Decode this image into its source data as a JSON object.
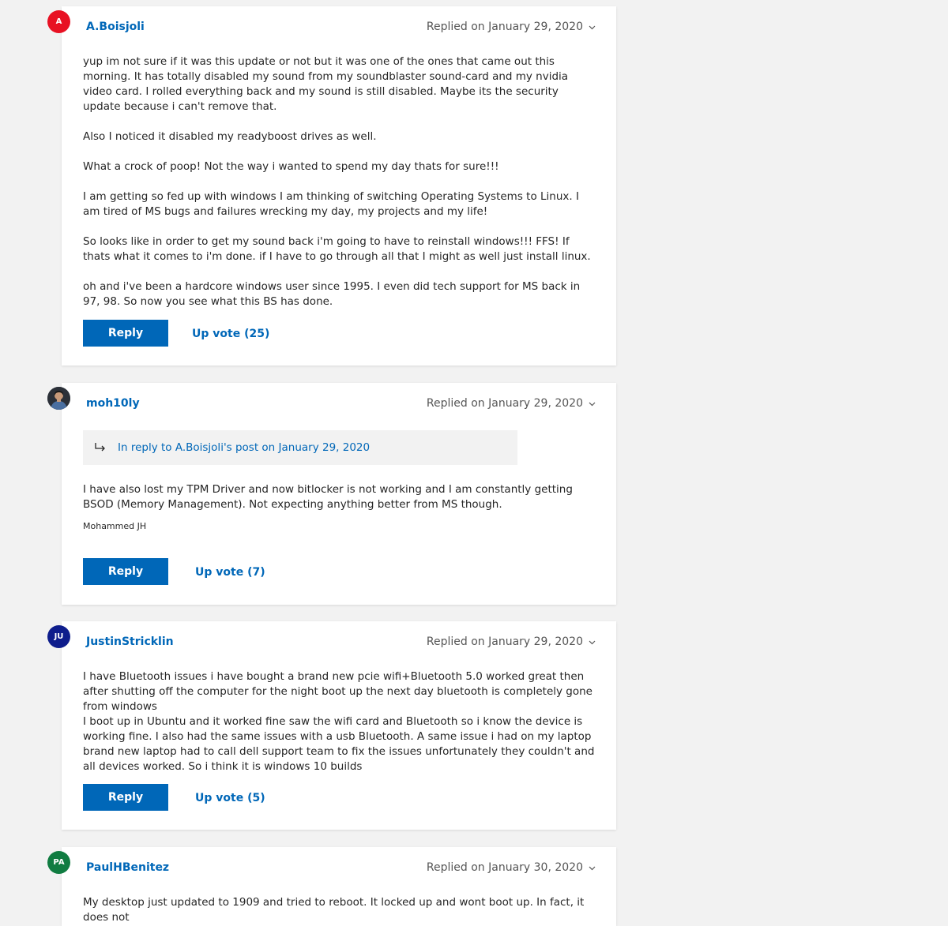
{
  "posts": [
    {
      "author": "A.Boisjoli",
      "avatar_initials": "A",
      "avatar_color": "#e81123",
      "replied": "Replied on January 29, 2020",
      "paragraphs": [
        "yup im not sure if it was this update or not but it was one of the ones that came out this morning. It has totally disabled my sound from my soundblaster sound-card and my nvidia video card. I rolled everything back and my sound is still disabled. Maybe its the security update because i can't remove that.",
        "Also I noticed it disabled my readyboost drives as well.",
        "What a crock of poop! Not the way i wanted to spend my day thats for sure!!!",
        "I am getting so fed up with windows I am thinking of switching Operating Systems to Linux. I am tired of MS bugs and failures wrecking my day, my projects and my life!",
        "So looks like in order to get my sound back i'm going to have to reinstall windows!!! FFS! If thats what it comes to i'm done. if I have to go through all that I might as well just install linux.",
        "oh and i've been a hardcore windows user since 1995. I even did tech support for MS back in 97, 98. So now you see what this BS has done."
      ],
      "reply_label": "Reply",
      "upvote_label": "Up vote (25)"
    },
    {
      "author": "moh10ly",
      "avatar_icon": "user-photo-icon",
      "replied": "Replied on January 29, 2020",
      "in_reply_to": "In reply to A.Boisjoli's post on January 29, 2020",
      "paragraphs": [
        "I have also lost my TPM Driver and now bitlocker is not working and I am constantly getting BSOD (Memory Management). Not expecting anything better from MS though."
      ],
      "signature": "Mohammed JH",
      "reply_label": "Reply",
      "upvote_label": "Up vote (7)"
    },
    {
      "author": "JustinStricklin",
      "avatar_initials": "JU",
      "avatar_color": "#0e1d8c",
      "replied": "Replied on January 29, 2020",
      "paragraphs": [
        "I have Bluetooth issues i have bought a brand new pcie wifi+Bluetooth 5.0 worked great then after shutting off the computer for the night boot up the next day bluetooth is completely gone from windows\nI boot up in Ubuntu and it worked fine saw the wifi card and Bluetooth so i know the device is working fine. I also had the same issues with a usb Bluetooth. A same issue i had on my laptop brand new laptop had to call dell support team to fix the issues unfortunately they couldn't and all devices worked. So i think it is windows 10 builds"
      ],
      "reply_label": "Reply",
      "upvote_label": "Up vote (5)"
    },
    {
      "author": "PaulHBenitez",
      "avatar_initials": "PA",
      "avatar_color": "#107c41",
      "replied": "Replied on January 30, 2020",
      "paragraphs": [
        "My desktop just updated to 1909 and tried to reboot.  It locked up and wont boot up.  In fact, it does not"
      ]
    }
  ]
}
